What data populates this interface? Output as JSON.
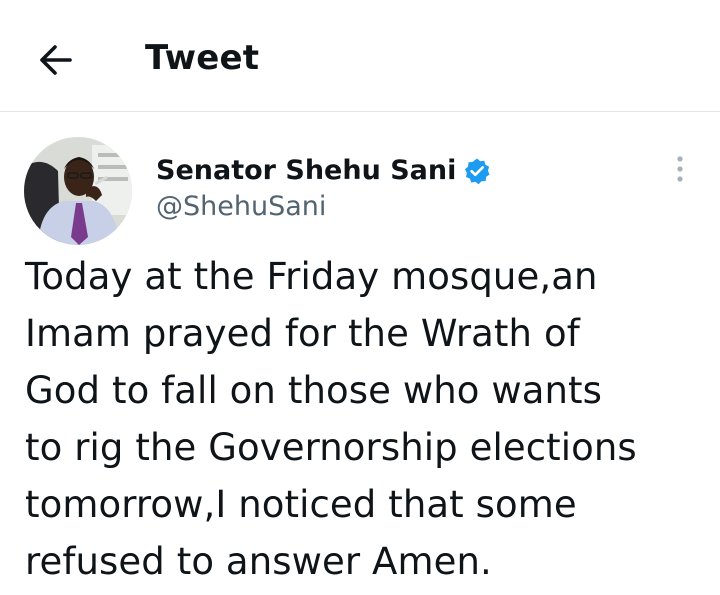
{
  "header": {
    "back_icon": "arrow-left-icon",
    "title": "Tweet"
  },
  "tweet": {
    "author": {
      "display_name": "Senator Shehu Sani",
      "handle": "@ShehuSani",
      "verified_icon": "verified-badge-icon"
    },
    "more_icon": "more-vertical-icon",
    "text": "Today at the Friday mosque,an\nImam prayed for the Wrath of\nGod to fall on those who wants\nto rig the Governorship elections\ntomorrow,I noticed that some\nrefused to answer Amen."
  },
  "colors": {
    "text_primary": "#0f1419",
    "text_secondary": "#536471",
    "verified_blue": "#1d9bf0",
    "divider": "#e3e6e8"
  }
}
